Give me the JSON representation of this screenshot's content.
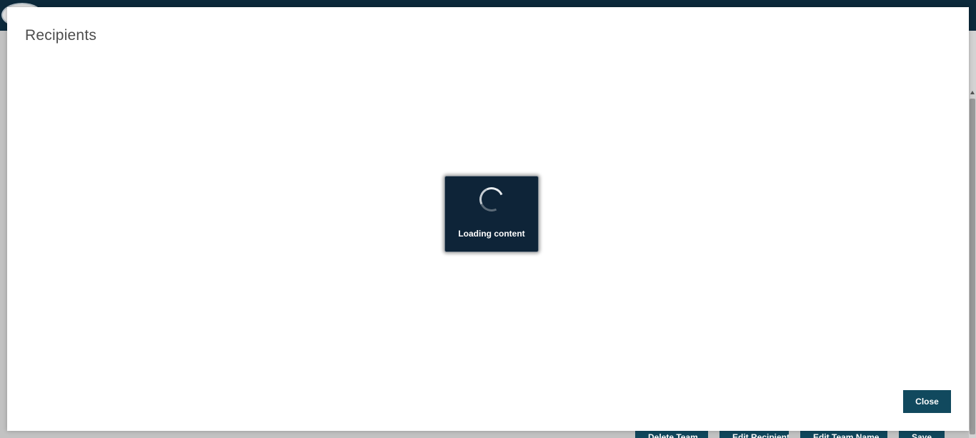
{
  "modal": {
    "title": "Recipients",
    "close_label": "Close"
  },
  "loader": {
    "text": "Loading content"
  },
  "background": {
    "buttons": [
      {
        "label": "Delete Team"
      },
      {
        "label": "Edit Recipients"
      },
      {
        "label": "Edit Team Name"
      },
      {
        "label": "Save"
      }
    ]
  },
  "colors": {
    "header": "#0d2a3d",
    "button": "#11495e",
    "loader_bg": "#0e2438",
    "modal_bg": "#ffffff",
    "backdrop": "#c6c6c6"
  }
}
